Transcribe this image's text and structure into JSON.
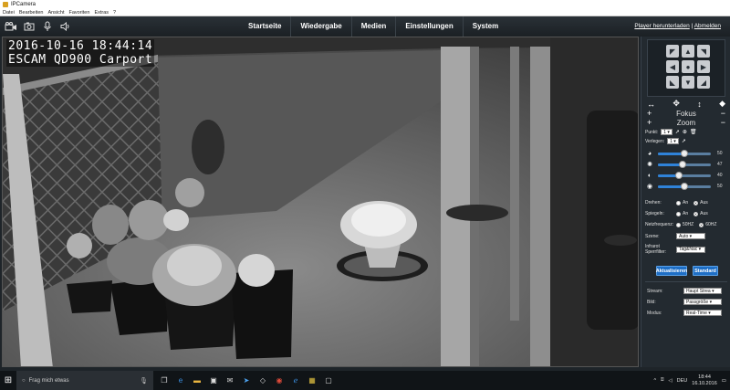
{
  "window": {
    "title": "IPCamera",
    "menu": [
      "Datei",
      "Bearbeiten",
      "Ansicht",
      "Favoriten",
      "Extras",
      "?"
    ]
  },
  "header": {
    "nav": [
      "Startseite",
      "Wiedergabe",
      "Medien",
      "Einstellungen",
      "System"
    ],
    "download_link": "Player herunterladen",
    "separator": "|",
    "logout_link": "Abmelden"
  },
  "video": {
    "osd_datetime": "2016-10-16 18:44:14",
    "osd_name": "ESCAM QD900 Carport"
  },
  "panel": {
    "focus_label": "Fokus",
    "zoom_label": "Zoom",
    "punkt_label": "Punkt:",
    "punkt_value": "1",
    "verlegen_label": "Verlegen:",
    "verlegen_value": "1",
    "sliders": [
      {
        "name": "brightness",
        "value": 50
      },
      {
        "name": "contrast",
        "value": 47
      },
      {
        "name": "saturation",
        "value": 40
      },
      {
        "name": "sharpness",
        "value": 50
      }
    ],
    "drehen": {
      "label": "Drehen:",
      "opt1": "An",
      "opt2": "Aus",
      "selected": "Aus"
    },
    "spiegeln": {
      "label": "Spiegeln:",
      "opt1": "An",
      "opt2": "Aus",
      "selected": "Aus"
    },
    "netzfrequenz": {
      "label": "Netzfrequenz:",
      "opt1": "50HZ",
      "opt2": "60HZ",
      "selected": "60HZ"
    },
    "szene": {
      "label": "Szene:",
      "value": "Auto"
    },
    "infrarot": {
      "label1": "Infrarot",
      "label2": "Sperrfilter:",
      "value": "Tag&Nac"
    },
    "btn_refresh": "Aktualisieren",
    "btn_default": "Standard",
    "stream": {
      "label": "Stream:",
      "value": "Haupt Strea"
    },
    "bild": {
      "label": "Bild:",
      "value": "Passgröße"
    },
    "modus": {
      "label": "Modus:",
      "value": "Real-Time"
    }
  },
  "taskbar": {
    "search_placeholder": "Frag mich etwas",
    "lang": "DEU",
    "time": "18:44",
    "date": "16.10.2016"
  }
}
